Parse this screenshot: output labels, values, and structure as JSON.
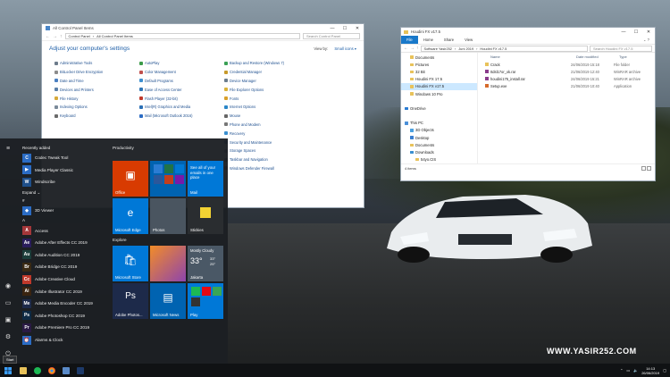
{
  "watermark": "WWW.YASIR252.COM",
  "control_panel": {
    "window_title": "All Control Panel Items",
    "address": [
      "Control Panel",
      "All Control Panel Items"
    ],
    "search_placeholder": "Search Control Panel",
    "heading": "Adjust your computer's settings",
    "view_by_label": "View by:",
    "view_by_value": "Small icons ▾",
    "columns": [
      [
        {
          "label": "Administrative Tools",
          "color": "#6d7c8c"
        },
        {
          "label": "BitLocker Drive Encryption",
          "color": "#8c8c8c"
        },
        {
          "label": "Date and Time",
          "color": "#4a7fc1"
        },
        {
          "label": "Devices and Printers",
          "color": "#5a7fa8"
        },
        {
          "label": "File History",
          "color": "#d6a93a"
        },
        {
          "label": "Indexing Options",
          "color": "#7b8a99"
        },
        {
          "label": "Keyboard",
          "color": "#6a6a6a"
        }
      ],
      [
        {
          "label": "AutoPlay",
          "color": "#3c9b4a"
        },
        {
          "label": "Color Management",
          "color": "#c0504d"
        },
        {
          "label": "Default Programs",
          "color": "#3c8fd0"
        },
        {
          "label": "Ease of Access Center",
          "color": "#2e75b6"
        },
        {
          "label": "Flash Player (32-bit)",
          "color": "#c0392b"
        },
        {
          "label": "Intel(R) Graphics and Media",
          "color": "#2a6fb5"
        },
        {
          "label": "Mail (Microsoft Outlook 2016)",
          "color": "#2b6cc4"
        }
      ],
      [
        {
          "label": "Backup and Restore (Windows 7)",
          "color": "#3aa055"
        },
        {
          "label": "Credential Manager",
          "color": "#c79a2b"
        },
        {
          "label": "Device Manager",
          "color": "#6b7d8e"
        },
        {
          "label": "File Explorer Options",
          "color": "#d9b23a"
        },
        {
          "label": "Fonts",
          "color": "#d9a02b"
        },
        {
          "label": "Internet Options",
          "color": "#2a86c8"
        },
        {
          "label": "Mouse",
          "color": "#666666"
        },
        {
          "label": "Phone and Modem",
          "color": "#777777"
        },
        {
          "label": "Recovery",
          "color": "#3a8fd0"
        },
        {
          "label": "Security and Maintenance",
          "color": "#2f6fb8"
        },
        {
          "label": "Storage Spaces",
          "color": "#7a8a99"
        },
        {
          "label": "Taskbar and Navigation",
          "color": "#4a6a8a"
        },
        {
          "label": "Windows Defender Firewall",
          "color": "#c0504d"
        }
      ]
    ]
  },
  "explorer": {
    "window_title": "Houdini FX v17.5",
    "ribbon_tabs": [
      "File",
      "Home",
      "Share",
      "View"
    ],
    "address": [
      "Software Yasir252",
      "Juni 2019",
      "Houdini FX v17.5"
    ],
    "search_placeholder": "Search Houdini FX v17.5",
    "nav": [
      {
        "label": "Documents",
        "color": "#e8c25a",
        "indent": 1
      },
      {
        "label": "Pictures",
        "color": "#e8c25a",
        "indent": 1
      },
      {
        "label": "32 Bit",
        "color": "#e8c25a",
        "indent": 1
      },
      {
        "label": "Houdini FX 17.5",
        "color": "#e8c25a",
        "indent": 1
      },
      {
        "label": "Houdini FX v17.5",
        "color": "#e8c25a",
        "indent": 1,
        "selected": true
      },
      {
        "label": "Windows 10 Pro",
        "color": "#e8c25a",
        "indent": 1
      },
      {
        "label": "",
        "color": "",
        "indent": 0
      },
      {
        "label": "OneDrive",
        "color": "#2b7cd3",
        "indent": 0
      },
      {
        "label": "",
        "color": "",
        "indent": 0
      },
      {
        "label": "This PC",
        "color": "#4a90d9",
        "indent": 0
      },
      {
        "label": "3D Objects",
        "color": "#4aa0e0",
        "indent": 1
      },
      {
        "label": "Desktop",
        "color": "#3b7fd0",
        "indent": 1
      },
      {
        "label": "Documents",
        "color": "#e8c25a",
        "indent": 1
      },
      {
        "label": "Downloads",
        "color": "#3a8fd0",
        "indent": 1
      },
      {
        "label": "54yo.CIS",
        "color": "#e8c25a",
        "indent": 2
      }
    ],
    "columns": [
      "Name",
      "Date modified",
      "Type"
    ],
    "files": [
      {
        "name": "Crack",
        "date": "24/06/2019 15:18",
        "type": "File folder",
        "color": "#e8c25a"
      },
      {
        "name": "Itdsl17or_xk.rar",
        "date": "21/06/2019 12:40",
        "type": "WinRAR archive",
        "color": "#8a3c8c"
      },
      {
        "name": "houdini175_install.rar",
        "date": "24/06/2019 15:21",
        "type": "WinRAR archive",
        "color": "#8a3c8c"
      },
      {
        "name": "Setup.exe",
        "date": "21/06/2019 10:40",
        "type": "Application",
        "color": "#d66a2b"
      }
    ],
    "status": "4 items"
  },
  "start_menu": {
    "recently_added_label": "Recently added",
    "recent": [
      {
        "label": "Codec Tweak Tool",
        "color": "#2b6cc4",
        "glyph": "C"
      },
      {
        "label": "Media Player Classic",
        "color": "#2b6cc4",
        "glyph": "▶"
      },
      {
        "label": "Windscribe",
        "color": "#1f4f8a",
        "glyph": "W"
      }
    ],
    "expand_label": "Expand ⌄",
    "hash_label": "#",
    "letter_a": "A",
    "apps_hash": [
      {
        "label": "3D Viewer",
        "color": "#2b6cc4",
        "glyph": "◆"
      }
    ],
    "apps_a": [
      {
        "label": "Access",
        "color": "#a4373a",
        "glyph": "A"
      },
      {
        "label": "Adobe After Effects CC 2019",
        "color": "#2a1d5c",
        "glyph": "Ae"
      },
      {
        "label": "Adobe Audition CC 2019",
        "color": "#1b3d3a",
        "glyph": "Au"
      },
      {
        "label": "Adobe Bridge CC 2019",
        "color": "#3a2a14",
        "glyph": "Br"
      },
      {
        "label": "Adobe Creative Cloud",
        "color": "#c0392b",
        "glyph": "Cc"
      },
      {
        "label": "Adobe Illustrator CC 2019",
        "color": "#3a2410",
        "glyph": "Ai"
      },
      {
        "label": "Adobe Media Encoder CC 2019",
        "color": "#1d2a4a",
        "glyph": "Me"
      },
      {
        "label": "Adobe Photoshop CC 2019",
        "color": "#0e2a44",
        "glyph": "Ps"
      },
      {
        "label": "Adobe Premiere Pro CC 2019",
        "color": "#2a1a44",
        "glyph": "Pr"
      },
      {
        "label": "Alarms & Clock",
        "color": "#2b6cc4",
        "glyph": "⏰"
      }
    ],
    "productivity_label": "Productivity",
    "explore_label": "Explore",
    "tiles": {
      "office": "Office",
      "mail_promo": "See all of your emails in one place",
      "mail": "Mail",
      "edge": "Microsoft Edge",
      "photos": "Photos",
      "stickies": "Stickies",
      "store": "Microsoft Store",
      "weather_cond": "Mostly Cloudy",
      "weather_temp": "33°",
      "weather_hi": "33°",
      "weather_lo": "25°",
      "weather_city": "Jakarta",
      "photoshop": "Adobe Photos...",
      "news": "Microsoft News",
      "play": "Play"
    }
  },
  "taskbar": {
    "start_tooltip": "Start",
    "time": "14:13",
    "date": "26/06/2019"
  }
}
